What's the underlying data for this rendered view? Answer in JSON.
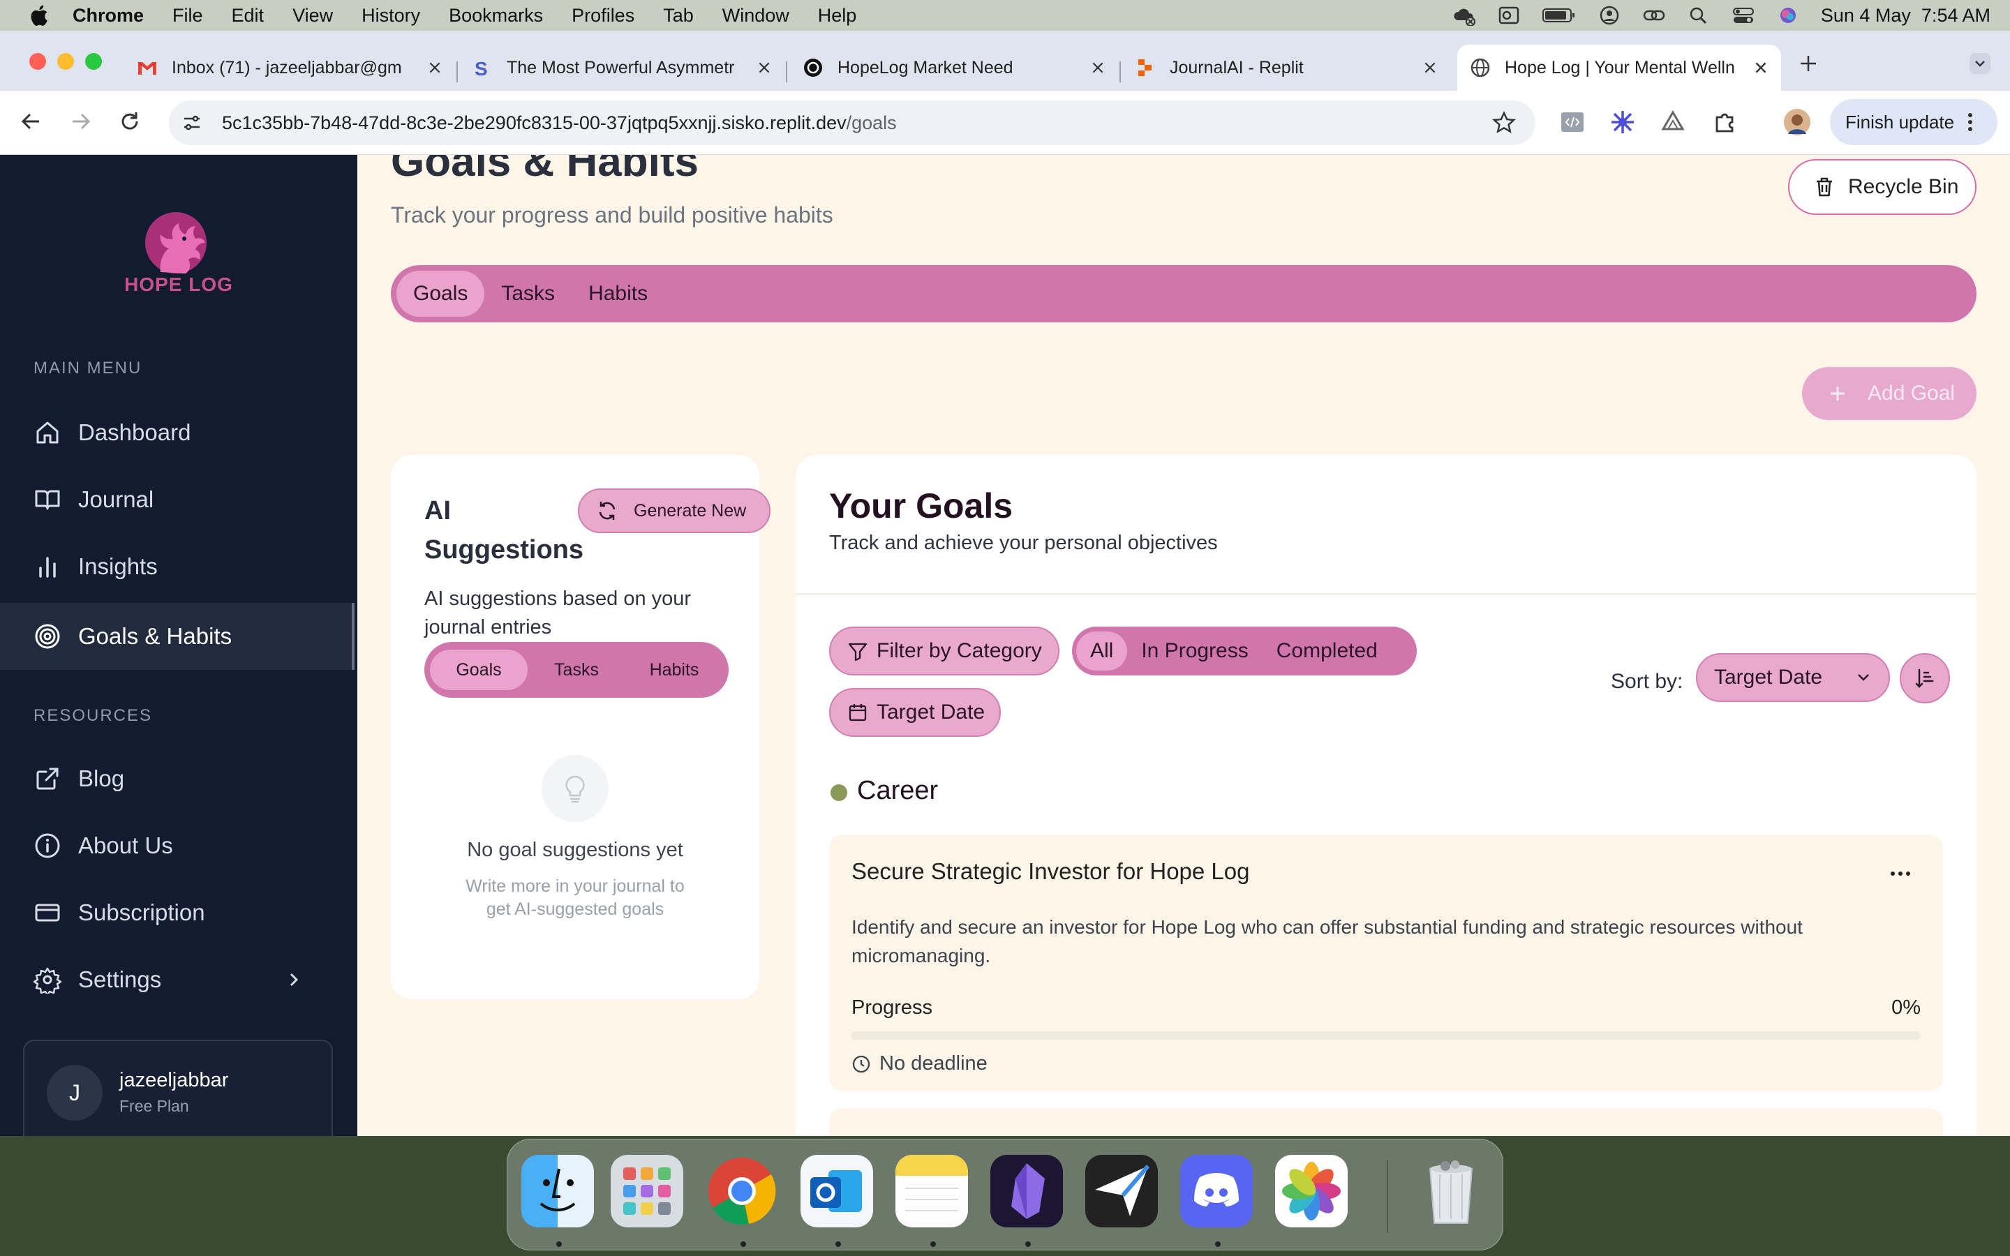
{
  "menubar": {
    "app": "Chrome",
    "items": [
      "File",
      "Edit",
      "View",
      "History",
      "Bookmarks",
      "Profiles",
      "Tab",
      "Window",
      "Help"
    ],
    "datetime": "Sun 4 May  7:54 AM"
  },
  "browser": {
    "tabs": [
      {
        "title": "Inbox (71) - jazeeljabbar@gm"
      },
      {
        "title": "The Most Powerful Asymmetr"
      },
      {
        "title": "HopeLog Market Need"
      },
      {
        "title": "JournalAI - Replit"
      },
      {
        "title": "Hope Log | Your Mental Welln"
      }
    ],
    "url_host": "5c1c35bb-7b48-47dd-8c3e-2be290fc8315-00-37jqtpq5xxnjj.sisko.replit.dev",
    "url_path": "/goals",
    "finish_update": "Finish update"
  },
  "sidebar": {
    "brand": "HOPE LOG",
    "main_menu_label": "MAIN MENU",
    "items": [
      {
        "label": "Dashboard",
        "icon": "home-icon"
      },
      {
        "label": "Journal",
        "icon": "book-icon"
      },
      {
        "label": "Insights",
        "icon": "bar-chart-icon"
      },
      {
        "label": "Goals & Habits",
        "icon": "target-icon",
        "active": true
      }
    ],
    "resources_label": "RESOURCES",
    "resources": [
      {
        "label": "Blog",
        "icon": "external-link-icon"
      },
      {
        "label": "About Us",
        "icon": "info-icon"
      },
      {
        "label": "Subscription",
        "icon": "credit-card-icon"
      },
      {
        "label": "Settings",
        "icon": "gear-icon"
      }
    ],
    "user": {
      "initial": "J",
      "name": "jazeeljabbar",
      "plan": "Free Plan"
    }
  },
  "page": {
    "title": "Goals & Habits",
    "subtitle": "Track your progress and build positive habits",
    "recycle_bin": "Recycle Bin",
    "tabs": [
      "Goals",
      "Tasks",
      "Habits"
    ],
    "active_tab": "Goals",
    "add_goal": "Add Goal"
  },
  "ai_suggestions": {
    "title": "AI Suggestions",
    "generate": "Generate New",
    "description": "AI suggestions based on your journal entries",
    "tabs": [
      "Goals",
      "Tasks",
      "Habits"
    ],
    "empty_title": "No goal suggestions yet",
    "empty_sub": "Write more in your journal to get AI-suggested goals"
  },
  "goals": {
    "title": "Your Goals",
    "subtitle": "Track and achieve your personal objectives",
    "filter_category": "Filter by Category",
    "status_filters": [
      "All",
      "In Progress",
      "Completed"
    ],
    "target_date_filter": "Target Date",
    "sort_label": "Sort by:",
    "sort_value": "Target Date",
    "category": {
      "name": "Career",
      "color": "#8a9a5b"
    },
    "items": [
      {
        "title": "Secure Strategic Investor for Hope Log",
        "description": "Identify and secure an investor for Hope Log who can offer substantial funding and strategic resources without micromanaging.",
        "progress_label": "Progress",
        "progress_value": "0%",
        "progress_fraction": 0,
        "deadline": "No deadline"
      }
    ]
  },
  "colors": {
    "sidebar_bg": "#131b30",
    "accent_pink": "#d176ad",
    "page_bg": "#fdf5e7"
  }
}
